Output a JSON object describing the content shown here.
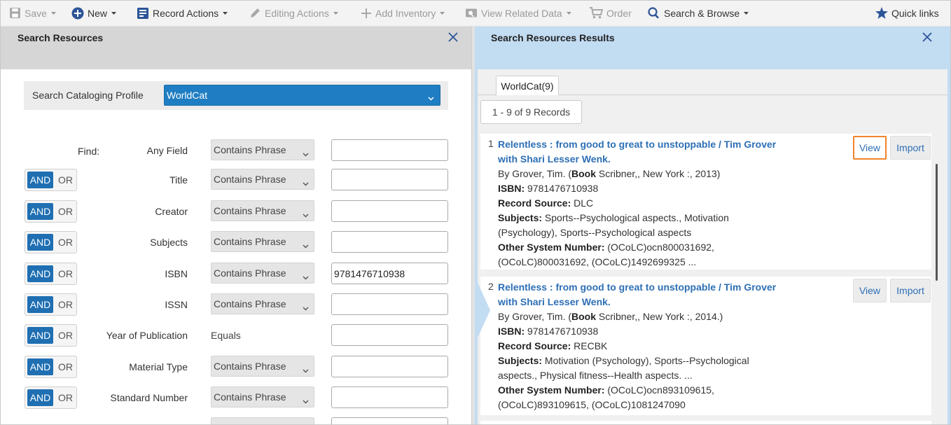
{
  "toolbar": {
    "save": "Save",
    "new": "New",
    "record_actions": "Record Actions",
    "editing_actions": "Editing Actions",
    "add_inventory": "Add Inventory",
    "view_related_data": "View Related Data",
    "order": "Order",
    "search_browse": "Search & Browse",
    "quick_links": "Quick links"
  },
  "colors": {
    "accent": "#1f7ec3",
    "and_active": "#1f6fb2",
    "results_bg": "#c2dcf2",
    "link": "#2d6fb5",
    "highlight": "#f0842c"
  },
  "search_panel": {
    "title": "Search Resources",
    "profile_label": "Search Cataloging Profile",
    "profile_value": "WorldCat",
    "find_label": "Find:",
    "rows": [
      {
        "boolean": "",
        "or": "",
        "field": "Any Field",
        "operator": "Contains Phrase",
        "value": ""
      },
      {
        "boolean": "AND",
        "or": "OR",
        "field": "Title",
        "operator": "Contains Phrase",
        "value": ""
      },
      {
        "boolean": "AND",
        "or": "OR",
        "field": "Creator",
        "operator": "Contains Phrase",
        "value": ""
      },
      {
        "boolean": "AND",
        "or": "OR",
        "field": "Subjects",
        "operator": "Contains Phrase",
        "value": ""
      },
      {
        "boolean": "AND",
        "or": "OR",
        "field": "ISBN",
        "operator": "Contains Phrase",
        "value": "9781476710938"
      },
      {
        "boolean": "AND",
        "or": "OR",
        "field": "ISSN",
        "operator": "Contains Phrase",
        "value": ""
      },
      {
        "boolean": "AND",
        "or": "OR",
        "field": "Year of Publication",
        "operator": "Equals",
        "value": ""
      },
      {
        "boolean": "AND",
        "or": "OR",
        "field": "Material Type",
        "operator": "Contains Phrase",
        "value": ""
      },
      {
        "boolean": "AND",
        "or": "OR",
        "field": "Standard Number",
        "operator": "Contains Phrase",
        "value": ""
      }
    ]
  },
  "results_panel": {
    "title": "Search Resources Results",
    "tab_label": "WorldCat(9)",
    "record_count": "1 - 9 of 9 Records",
    "view_label": "View",
    "import_label": "Import",
    "results": [
      {
        "num": "1",
        "title": "Relentless : from good to great to unstoppable / Tim Grover with Shari Lesser Wenk.",
        "by_prefix": "By Grover, Tim. (",
        "format": "Book",
        "publisher": " Scribner,, New York :, 2013)",
        "isbn_label": "ISBN:",
        "isbn": " 9781476710938",
        "source_label": "Record Source:",
        "source": " DLC",
        "subjects_label": "Subjects:",
        "subjects_1": " Sports--Psychological aspects., Motivation",
        "subjects_2": "(Psychology), Sports--Psychological aspects",
        "other_label": "Other System Number:",
        "other_1": " (OCoLC)ocn800031692,",
        "other_2": "(OCoLC)800031692, (OCoLC)1492699325 ..."
      },
      {
        "num": "2",
        "title": "Relentless : from good to great to unstoppable / Tim Grover with Shari Lesser Wenk.",
        "by_prefix": "By Grover, Tim. (",
        "format": "Book",
        "publisher": " Scribner,, New York :, 2014.)",
        "isbn_label": "ISBN:",
        "isbn": " 9781476710938",
        "source_label": "Record Source:",
        "source": " RECBK",
        "subjects_label": "Subjects:",
        "subjects_1": " Motivation (Psychology), Sports--Psychological",
        "subjects_2": "aspects., Physical fitness--Health aspects. ...",
        "other_label": "Other System Number:",
        "other_1": " (OCoLC)ocn893109615,",
        "other_2": "(OCoLC)893109615, (OCoLC)1081247090"
      }
    ]
  }
}
